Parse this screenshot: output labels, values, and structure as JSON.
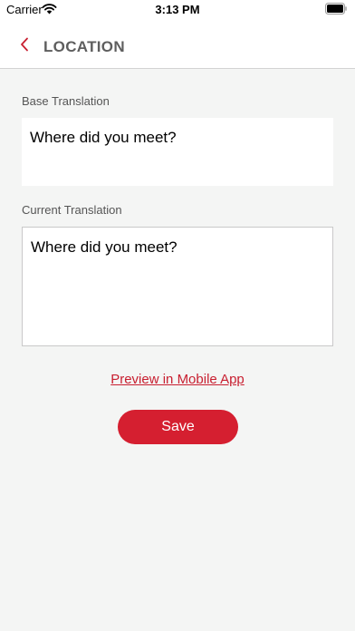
{
  "status_bar": {
    "carrier": "Carrier",
    "time": "3:13 PM",
    "icons": [
      "wifi-icon",
      "battery-icon"
    ]
  },
  "nav": {
    "back_icon": "chevron-left-icon",
    "title": "LOCATION"
  },
  "form": {
    "base_label": "Base Translation",
    "base_value": "Where did you meet?",
    "current_label": "Current Translation",
    "current_value": "Where did you meet?"
  },
  "actions": {
    "preview_link": "Preview in Mobile App",
    "save_label": "Save"
  },
  "colors": {
    "accent": "#d51f30",
    "background": "#f4f5f4",
    "title": "#5e5e5e"
  }
}
